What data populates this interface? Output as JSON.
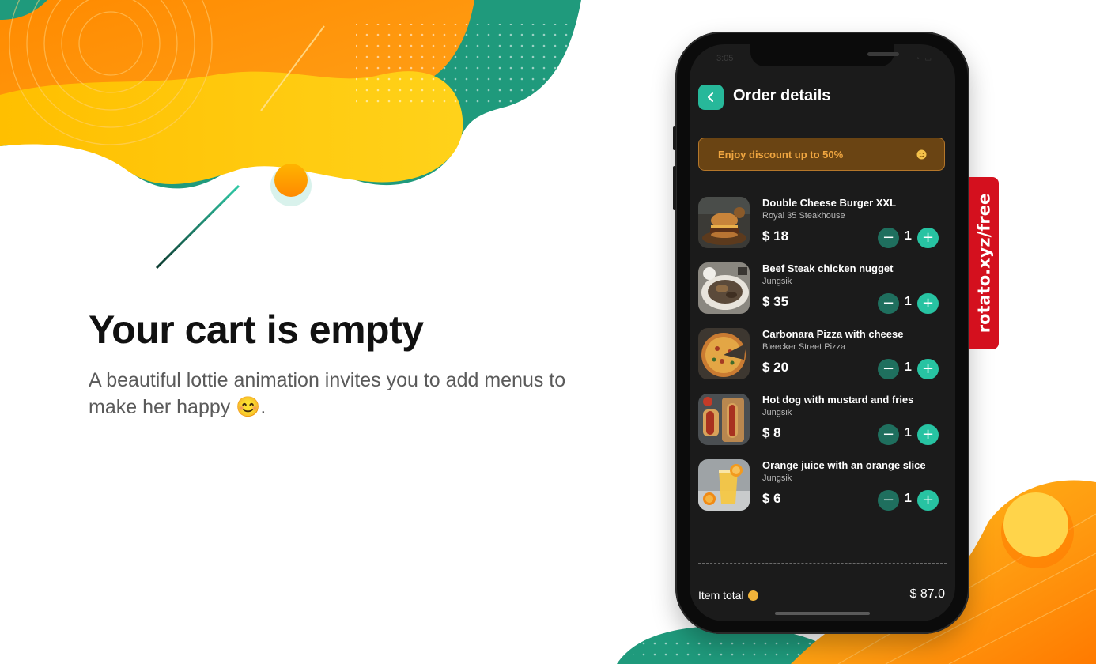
{
  "hero": {
    "title": "Your cart is empty",
    "subtitle": "A beautiful lottie animation invites you to add menus to make her happy 😊."
  },
  "status_bar": {
    "time": "3:05",
    "icons": "wifi battery"
  },
  "header": {
    "title": "Order details",
    "back_icon": "chevron-left-icon"
  },
  "discount": {
    "text": "Enjoy discount up to 50%",
    "icon": "smiley-icon"
  },
  "items": [
    {
      "name": "Double Cheese Burger XXL",
      "shop": "Royal 35 Steakhouse",
      "price": "$ 18",
      "qty": "1"
    },
    {
      "name": "Beef Steak chicken nugget",
      "shop": "Jungsik",
      "price": "$ 35",
      "qty": "1"
    },
    {
      "name": "Carbonara Pizza with cheese",
      "shop": "Bleecker Street Pizza",
      "price": "$ 20",
      "qty": "1"
    },
    {
      "name": "Hot dog with mustard and fries",
      "shop": "Jungsik",
      "price": "$ 8",
      "qty": "1"
    },
    {
      "name": "Orange juice with an orange slice",
      "shop": "Jungsik",
      "price": "$ 6",
      "qty": "1"
    }
  ],
  "stepper": {
    "minus": "−",
    "plus": "+"
  },
  "total": {
    "label": "Item total",
    "value": "$ 87.0"
  },
  "watermark": {
    "text": "rotato.xyz/free"
  },
  "colors": {
    "accent": "#27b89a",
    "discount_bg": "#6a4413",
    "discount_text": "#f0a640",
    "screen_bg": "#1b1b1b",
    "watermark_bg": "#d4101e"
  }
}
